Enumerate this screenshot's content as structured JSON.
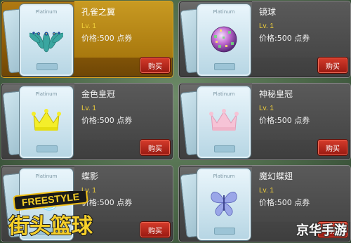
{
  "items": [
    {
      "name": "孔雀之翼",
      "level": "Lv. 1",
      "price": "价格:500 点券",
      "buy_label": "购买",
      "ticket_label": "Platinum",
      "icon": "peacock-wing-icon",
      "selected": true
    },
    {
      "name": "镜球",
      "level": "Lv. 1",
      "price": "价格:500 点券",
      "buy_label": "购买",
      "ticket_label": "Platinum",
      "icon": "mirror-ball-icon",
      "selected": false
    },
    {
      "name": "金色皇冠",
      "level": "Lv. 1",
      "price": "价格:500 点券",
      "buy_label": "购买",
      "ticket_label": "Platinum",
      "icon": "gold-crown-icon",
      "selected": false
    },
    {
      "name": "神秘皇冠",
      "level": "Lv. 1",
      "price": "价格:500 点券",
      "buy_label": "购买",
      "ticket_label": "Platinum",
      "icon": "pink-crown-icon",
      "selected": false
    },
    {
      "name": "蝶影",
      "level": "Lv. 1",
      "price": "价格:500 点券",
      "buy_label": "购买",
      "ticket_label": "Platinum",
      "icon": "butterfly-shadow-icon",
      "selected": false
    },
    {
      "name": "魔幻蝶翅",
      "level": "Lv. 1",
      "price": "价格:500 点券",
      "buy_label": "购买",
      "ticket_label": "Platinum",
      "icon": "butterfly-wing-icon",
      "selected": false
    }
  ],
  "logo": {
    "line1": "FREESTYLE",
    "line2": "街头篮球"
  },
  "watermark": "京华手游",
  "colors": {
    "accent_selected": "#b07a12",
    "level_text": "#f2d13a",
    "buy_button": "#c0281c"
  }
}
